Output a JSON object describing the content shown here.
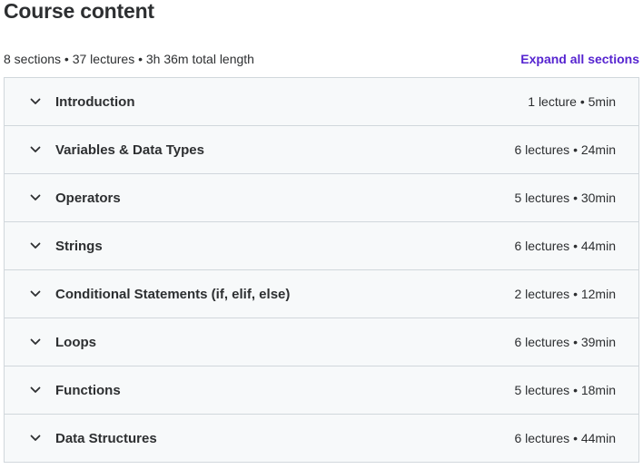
{
  "header": {
    "title": "Course content",
    "summary": "8 sections • 37 lectures • 3h 36m total length",
    "expand_all_label": "Expand all sections"
  },
  "accent_color": "#5624d0",
  "section_icon": "chevron-down-icon",
  "sections": [
    {
      "title": "Introduction",
      "meta": "1 lecture • 5min"
    },
    {
      "title": "Variables & Data Types",
      "meta": "6 lectures • 24min"
    },
    {
      "title": "Operators",
      "meta": "5 lectures • 30min"
    },
    {
      "title": "Strings",
      "meta": "6 lectures • 44min"
    },
    {
      "title": "Conditional Statements (if, elif, else)",
      "meta": "2 lectures • 12min"
    },
    {
      "title": "Loops",
      "meta": "6 lectures • 39min"
    },
    {
      "title": "Functions",
      "meta": "5 lectures • 18min"
    },
    {
      "title": "Data Structures",
      "meta": "6 lectures • 44min"
    }
  ]
}
